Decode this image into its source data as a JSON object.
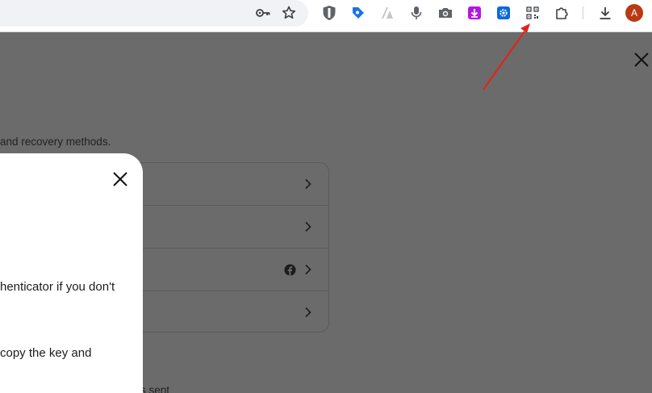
{
  "browser": {
    "avatar_letter": "A",
    "icons": [
      "key-icon",
      "star-icon",
      "shield-extension-icon",
      "tag-extension-icon",
      "vector-extension-icon",
      "microphone-icon",
      "camera-icon",
      "download-arrow-extension-icon",
      "gear-extension-icon",
      "qr-code-icon",
      "puzzle-extensions-icon",
      "download-icon",
      "profile-avatar"
    ]
  },
  "page": {
    "description_fragment": "and recovery methods.",
    "footer_fragment": "s sent"
  },
  "modal": {
    "line1": "henticator if you don't",
    "line2": "copy the key and"
  },
  "colors": {
    "overlay": "#6b6b6b",
    "annotation": "#e0241b",
    "avatar": "#b93a12"
  }
}
